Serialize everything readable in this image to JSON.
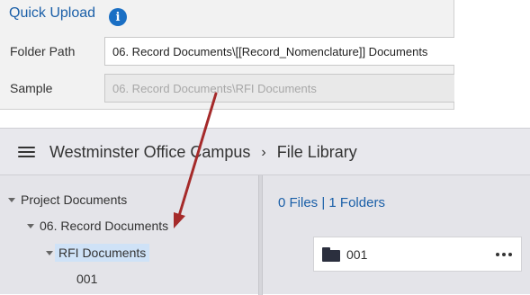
{
  "quick_upload": {
    "title": "Quick Upload",
    "info_icon": "i",
    "folder_path_label": "Folder Path",
    "folder_path_value": "06. Record Documents\\[[Record_Nomenclature]] Documents",
    "sample_label": "Sample",
    "sample_value": "06. Record Documents\\RFI Documents"
  },
  "file_library": {
    "breadcrumb": {
      "project": "Westminster Office Campus",
      "separator": "›",
      "page": "File Library"
    },
    "tree": [
      {
        "label": "Project Documents",
        "expanded": true
      },
      {
        "label": "06. Record Documents",
        "expanded": true
      },
      {
        "label": "RFI Documents",
        "expanded": true,
        "selected": true
      },
      {
        "label": "001",
        "expanded": false
      }
    ],
    "summary": "0 Files | 1 Folders",
    "folders": [
      {
        "name": "001",
        "icon": "folder-icon"
      }
    ]
  },
  "colors": {
    "accent": "#1a5fa8",
    "arrow": "#a52a2a",
    "selection": "#cfe2f7"
  }
}
